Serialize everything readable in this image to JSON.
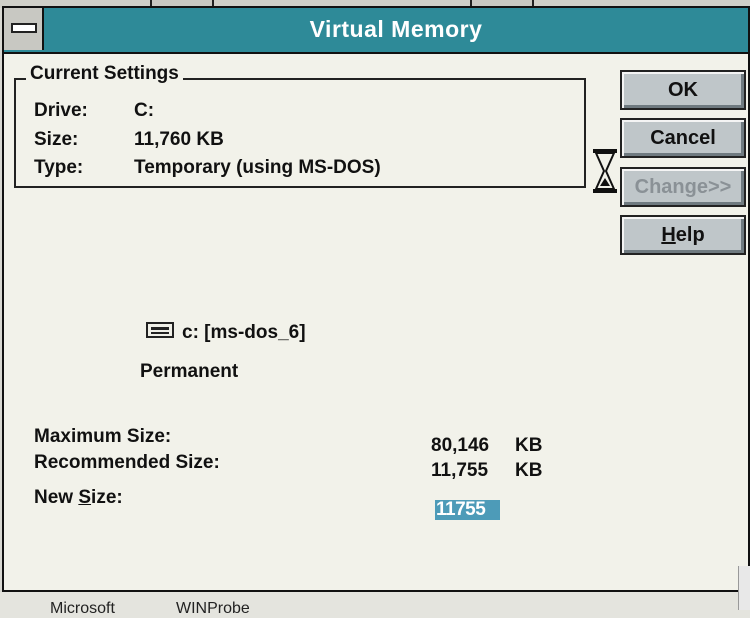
{
  "dialog": {
    "title": "Virtual Memory"
  },
  "current_settings": {
    "group_label": "Current Settings",
    "drive_label": "Drive:",
    "drive_value": "C:",
    "size_label": "Size:",
    "size_value": "11,760 KB",
    "type_label": "Type:",
    "type_value": "Temporary (using MS-DOS)"
  },
  "buttons": {
    "ok": "OK",
    "cancel": "Cancel",
    "change": "Change>>",
    "help_prefix": "H",
    "help_rest": "elp"
  },
  "drive_section": {
    "drive_name": "c: [ms-dos_6]",
    "type": "Permanent"
  },
  "sizes": {
    "max_label": "Maximum Size:",
    "max_value": "80,146",
    "max_unit": "KB",
    "rec_label": "Recommended Size:",
    "rec_value": "11,755",
    "rec_unit": "KB",
    "new_label_pre": "New ",
    "new_label_u": "S",
    "new_label_post": "ize:",
    "new_value": "11755"
  },
  "taskbar": {
    "item1": "Microsoft",
    "item2": "WINProbe"
  },
  "colors": {
    "titlebar": "#2e8a98",
    "selection": "#4d9bb8"
  }
}
